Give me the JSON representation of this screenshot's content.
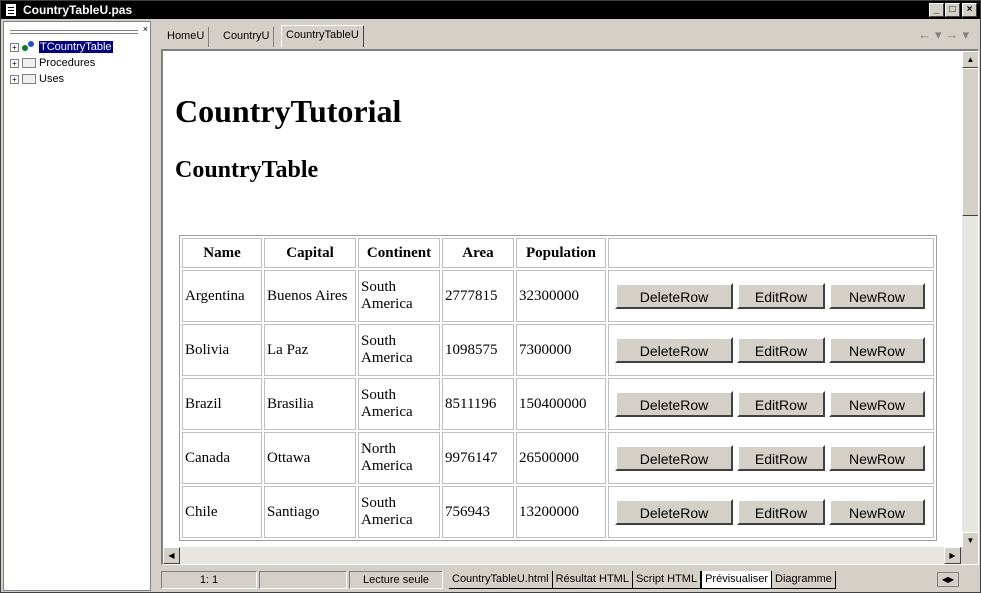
{
  "window": {
    "title": "CountryTableU.pas"
  },
  "explorer": {
    "items": [
      {
        "label": "TCountryTable",
        "kind": "class",
        "selected": true
      },
      {
        "label": "Procedures",
        "kind": "folder"
      },
      {
        "label": "Uses",
        "kind": "folder"
      }
    ]
  },
  "doc_tabs": [
    "HomeU",
    "CountryU",
    "CountryTableU"
  ],
  "active_doc_tab": "CountryTableU",
  "page": {
    "heading": "CountryTutorial",
    "subheading": "CountryTable",
    "columns": [
      "Name",
      "Capital",
      "Continent",
      "Area",
      "Population"
    ],
    "buttons": {
      "delete": "DeleteRow",
      "edit": "EditRow",
      "new": "NewRow"
    },
    "rows": [
      {
        "name": "Argentina",
        "capital": "Buenos Aires",
        "continent": "South America",
        "area": "2777815",
        "population": "32300000"
      },
      {
        "name": "Bolivia",
        "capital": "La Paz",
        "continent": "South America",
        "area": "1098575",
        "population": "7300000"
      },
      {
        "name": "Brazil",
        "capital": "Brasilia",
        "continent": "South America",
        "area": "8511196",
        "population": "150400000"
      },
      {
        "name": "Canada",
        "capital": "Ottawa",
        "continent": "North America",
        "area": "9976147",
        "population": "26500000"
      },
      {
        "name": "Chile",
        "capital": "Santiago",
        "continent": "South America",
        "area": "756943",
        "population": "13200000"
      }
    ]
  },
  "status": {
    "position": "1:  1",
    "mode": "Lecture seule",
    "tabs": [
      "CountryTableU.html",
      "Résultat HTML",
      "Script HTML",
      "Prévisualiser",
      "Diagramme"
    ],
    "active_tab": "Prévisualiser"
  },
  "icons": {
    "title": "document-icon",
    "close": "close-icon",
    "minimize": "minimize-icon",
    "maximize": "maximize-icon",
    "back": "back-arrow-icon",
    "forward": "forward-arrow-icon"
  }
}
